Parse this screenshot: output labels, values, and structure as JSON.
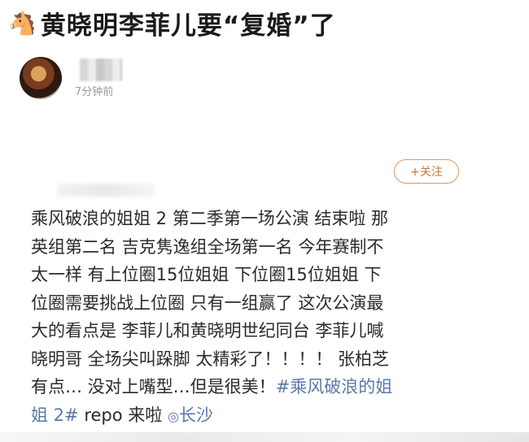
{
  "headline": {
    "icon": "horse-icon",
    "text": "黄晓明李菲儿要“复婚”了"
  },
  "post": {
    "timestamp": "7分钟前",
    "follow_label": "+关注",
    "lines": [
      "乘风破浪的姐姐 2 第二季第一场公演 结束啦 那",
      "英组第二名 吉克隽逸组全场第一名 今年赛制不",
      "太一样 有上位圈15位姐姐 下位圈15位姐姐 下",
      "位圈需要挑战上位圈 只有一组赢了 这次公演最",
      "大的看点是 李菲儿和黄晓明世纪同台 李菲儿喊",
      "晓明哥 全场尖叫跺脚 太精彩了！！！！ 张柏芝"
    ],
    "line7_text": "有点… 没对上嘴型…但是很美！",
    "topic_part1": "#乘风破浪的姐",
    "topic_part2": "姐 2#",
    "line8_text": " repo 来啦 ",
    "location_icon": "location-pin-icon",
    "location": "长沙"
  }
}
